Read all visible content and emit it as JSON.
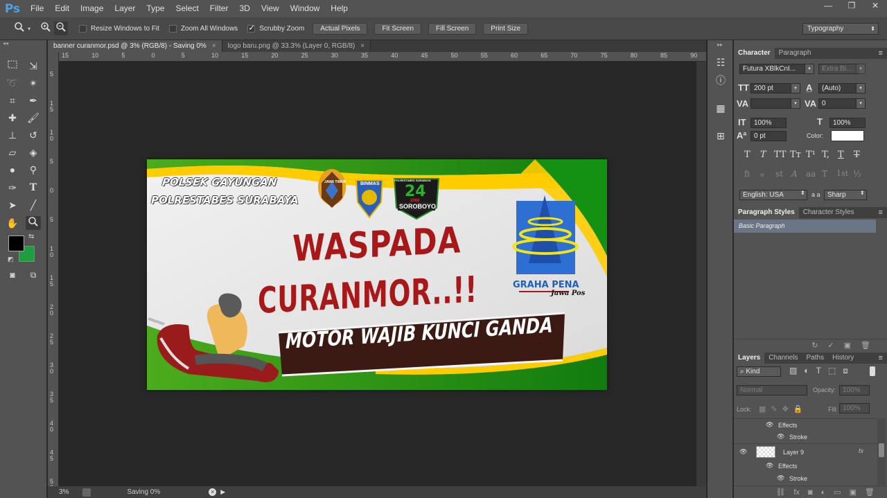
{
  "app": {
    "logo": "Ps"
  },
  "menu": [
    "File",
    "Edit",
    "Image",
    "Layer",
    "Type",
    "Select",
    "Filter",
    "3D",
    "View",
    "Window",
    "Help"
  ],
  "window_controls": [
    "—",
    "❐",
    "✕"
  ],
  "options_bar": {
    "resize_windows_to_fit": "Resize Windows to Fit",
    "zoom_all_windows": "Zoom All Windows",
    "scrubby_zoom": "Scrubby Zoom",
    "actual_pixels": "Actual Pixels",
    "fit_screen": "Fit Screen",
    "fill_screen": "Fill Screen",
    "print_size": "Print Size",
    "workspace": "Typography"
  },
  "doc_tabs": [
    {
      "label": "banner curanmor.psd @ 3% (RGB/8) - Saving 0%",
      "close": "×"
    },
    {
      "label": "logo baru.png @ 33.3% (Layer 0, RGB/8)",
      "close": "×"
    }
  ],
  "ruler_h": [
    "15",
    "10",
    "5",
    "0",
    "5",
    "10",
    "15",
    "20",
    "25",
    "30",
    "35",
    "40",
    "45",
    "50",
    "55",
    "60",
    "65",
    "70",
    "75",
    "80",
    "85",
    "90"
  ],
  "ruler_v": [
    "5",
    "1 5",
    "1 0",
    "5",
    "0",
    "5",
    "1 0",
    "1 5",
    "2 0",
    "2 5",
    "3 0",
    "3 5",
    "4 0",
    "4 5",
    "5 0"
  ],
  "status": {
    "zoom": "3%",
    "text": "Saving 0%"
  },
  "banner": {
    "org_line1": "POLSEK GAYUNGAN",
    "org_line2": "POLRESTABES SURABAYA",
    "headline1": "WASPADA",
    "headline2": "CURANMOR..!!",
    "subline": "MOTOR WAJIB KUNCI GANDA",
    "logo_title": "GRAHA PENA",
    "logo_sub": "Jawa Pos",
    "badge1_text": "JAWA TIMUR",
    "badge2_text": "BINMAS",
    "badge3_top": "POLRESTABES SURABAYA",
    "badge3_mid": "24",
    "badge3_small": "2060",
    "badge3_bottom": "SOROBOYO"
  },
  "character_panel": {
    "tabs": [
      "Character",
      "Paragraph"
    ],
    "font_family": "Futura XBlkCnI...",
    "font_style": "Extra Bl...",
    "size": "200 pt",
    "leading": "(Auto)",
    "kerning": "",
    "tracking": "0",
    "vscale": "100%",
    "hscale": "100%",
    "baseline": "0 pt",
    "color_label": "Color:",
    "language": "English: USA",
    "aa_label": "a a",
    "antialias": "Sharp",
    "text_style_buttons": [
      "T",
      "T",
      "TT",
      "Tт",
      "T¹",
      "T,",
      "T",
      "T"
    ],
    "opentype_buttons": [
      "fi",
      "ℴ",
      "st",
      "A",
      "aa",
      "T",
      "1st",
      "½"
    ]
  },
  "styles_panel": {
    "tabs": [
      "Paragraph Styles",
      "Character Styles"
    ],
    "items": [
      "Basic Paragraph"
    ]
  },
  "layers_panel": {
    "tabs": [
      "Layers",
      "Channels",
      "Paths",
      "History"
    ],
    "filter_kind": "Kind",
    "blend_mode": "Normal",
    "opacity_label": "Opacity:",
    "opacity": "100%",
    "lock_label": "Lock:",
    "fill_label": "Fill:",
    "fill": "100%",
    "rows": [
      {
        "name": "Effects",
        "type": "effects"
      },
      {
        "name": "Stroke",
        "type": "effect"
      },
      {
        "name": "Layer 9",
        "type": "layer",
        "fx": "fx"
      },
      {
        "name": "Effects",
        "type": "effects"
      },
      {
        "name": "Stroke",
        "type": "effect"
      }
    ]
  },
  "colors": {
    "foreground": "#000000",
    "background": "#1e9e3e",
    "banner_green": "#1b8f14",
    "banner_yellow": "#ffcc00",
    "headline_red": "#a81818",
    "sub_box": "#3b1a14"
  }
}
